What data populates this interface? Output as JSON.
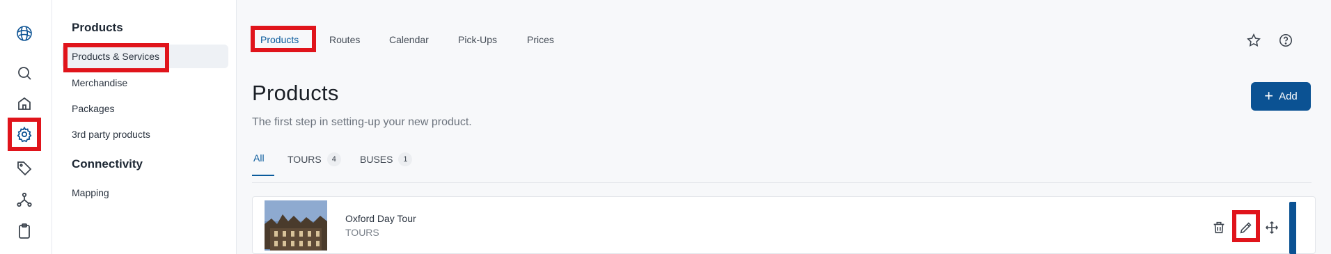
{
  "rail": {
    "icons": [
      "globe-logo-icon",
      "search-icon",
      "home-icon",
      "gear-icon",
      "tag-icon",
      "network-icon",
      "clipboard-icon"
    ]
  },
  "subnav": {
    "section1": "Products",
    "items1": [
      "Products & Services",
      "Merchandise",
      "Packages",
      "3rd party products"
    ],
    "section2": "Connectivity",
    "items2": [
      "Mapping"
    ]
  },
  "top_tabs": [
    "Products",
    "Routes",
    "Calendar",
    "Pick-Ups",
    "Prices"
  ],
  "page": {
    "title": "Products",
    "subtitle": "The first step in setting-up your new product.",
    "add_label": "Add"
  },
  "filters": [
    {
      "label": "All",
      "count": ""
    },
    {
      "label": "TOURS",
      "count": "4"
    },
    {
      "label": "BUSES",
      "count": "1"
    }
  ],
  "product": {
    "name": "Oxford Day Tour",
    "category": "TOURS"
  },
  "colors": {
    "accent": "#0b5293",
    "highlight": "#e0141b"
  }
}
